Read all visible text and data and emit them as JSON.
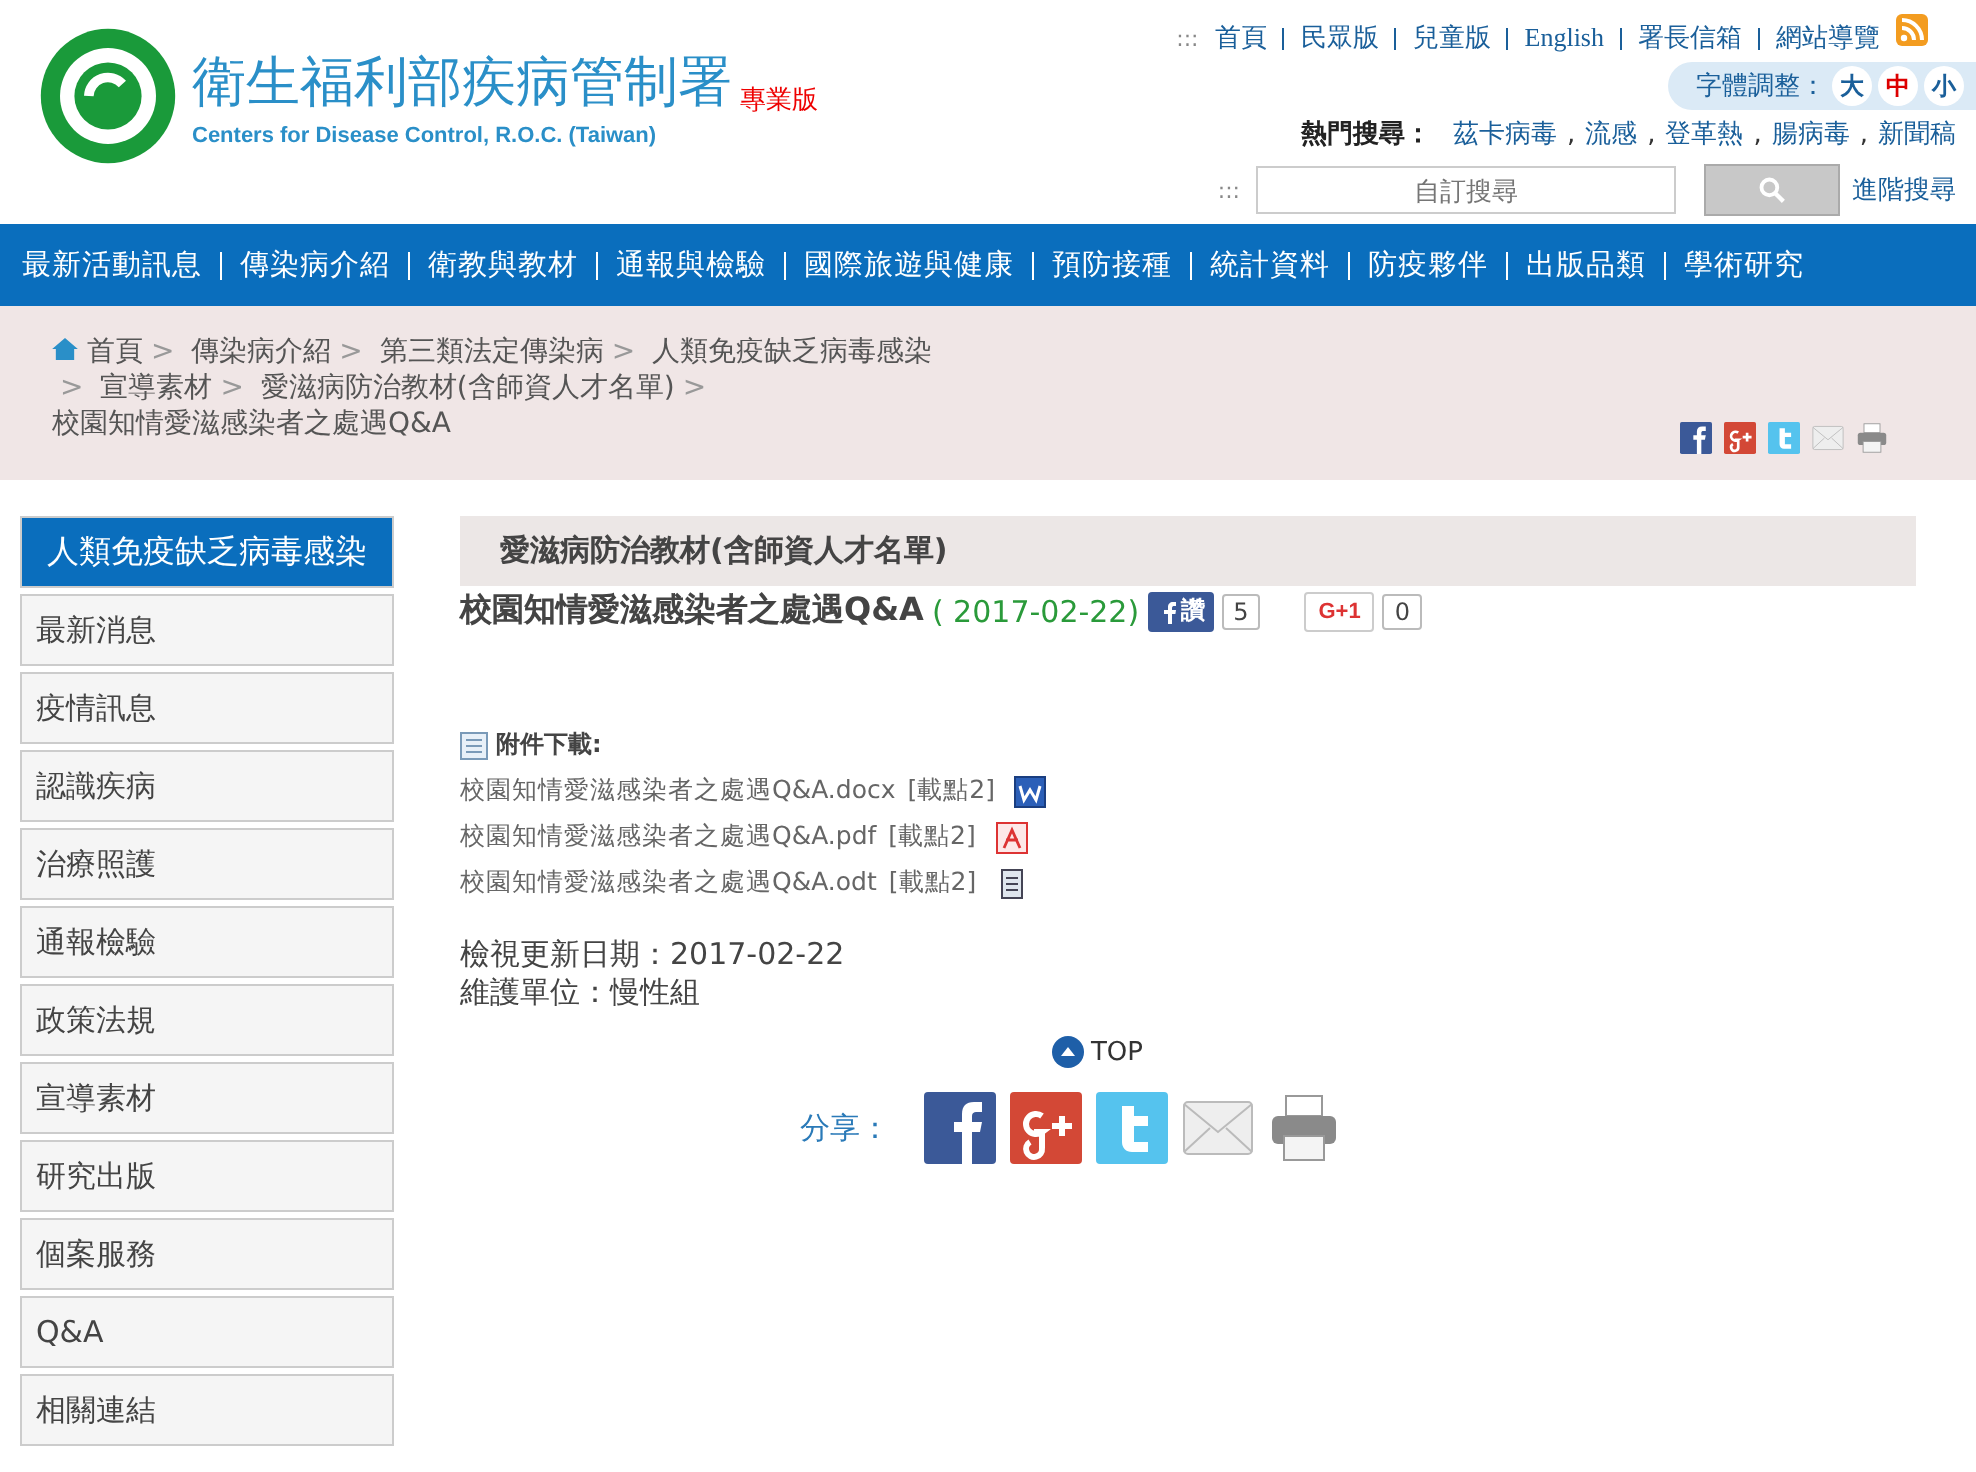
{
  "header": {
    "logo_title": "衛生福利部疾病管制署",
    "logo_subtitle": "Centers for Disease Control, R.O.C. (Taiwan)",
    "edition": "專業版",
    "top_marker": ":::",
    "top_links": [
      "首頁",
      "民眾版",
      "兒童版",
      "English",
      "署長信箱",
      "網站導覽"
    ],
    "font_size": {
      "label": "字體調整：",
      "options": [
        {
          "label": "大",
          "selected": false
        },
        {
          "label": "中",
          "selected": true
        },
        {
          "label": "小",
          "selected": false
        }
      ]
    },
    "hot_search": {
      "label": "熱門搜尋：",
      "terms": [
        {
          "text": "茲卡病毒",
          "sep": ","
        },
        {
          "text": "流感",
          "sep": ","
        },
        {
          "text": "登革熱",
          "sep": ","
        },
        {
          "text": "腸病毒",
          "sep": ","
        },
        {
          "text": "新聞稿"
        }
      ]
    },
    "search": {
      "marker": ":::",
      "placeholder": "自訂搜尋",
      "advanced_link": "進階搜尋"
    }
  },
  "nav": [
    "最新活動訊息",
    "傳染病介紹",
    "衛教與教材",
    "通報與檢驗",
    "國際旅遊與健康",
    "預防接種",
    "統計資料",
    "防疫夥伴",
    "出版品類",
    "學術研究"
  ],
  "breadcrumb": [
    {
      "text": "首頁"
    },
    {
      "sep": ">",
      "text": "傳染病介紹"
    },
    {
      "sep": ">",
      "text": "第三類法定傳染病"
    },
    {
      "sep": ">",
      "text": "人類免疫缺乏病毒感染"
    },
    {
      "sep": ">",
      "text": "宣導素材"
    },
    {
      "sep": ">",
      "text": "愛滋病防治教材(含師資人才名單)"
    },
    {
      "sep": ">",
      "text": "校園知情愛滋感染者之處遇Q&A"
    }
  ],
  "sidebar": [
    {
      "label": "人類免疫缺乏病毒感染",
      "selected": true
    },
    {
      "label": "最新消息",
      "selected": false
    },
    {
      "label": "疫情訊息",
      "selected": false
    },
    {
      "label": "認識疾病",
      "selected": false
    },
    {
      "label": "治療照護",
      "selected": false
    },
    {
      "label": "通報檢驗",
      "selected": false
    },
    {
      "label": "政策法規",
      "selected": false
    },
    {
      "label": "宣導素材",
      "selected": false
    },
    {
      "label": "研究出版",
      "selected": false
    },
    {
      "label": "個案服務",
      "selected": false
    },
    {
      "label": "Q&A",
      "selected": false
    },
    {
      "label": "相關連結",
      "selected": false
    }
  ],
  "content": {
    "section_title": "愛滋病防治教材(含師資人才名單)",
    "title": "校園知情愛滋感染者之處遇Q&A",
    "date": "( 2017-02-22)",
    "like_label": "讚",
    "like_count": "5",
    "plus_label": "G+1",
    "plus_count": "0",
    "attachments_label": "附件下載:",
    "attachments": [
      {
        "name": "校園知情愛滋感染者之處遇Q&A.docx",
        "clicks": "[載點2]",
        "kind": "word"
      },
      {
        "name": "校園知情愛滋感染者之處遇Q&A.pdf",
        "clicks": "[載點2]",
        "kind": "pdf"
      },
      {
        "name": "校園知情愛滋感染者之處遇Q&A.odt",
        "clicks": "[載點2]",
        "kind": "odt"
      }
    ],
    "updated": "檢視更新日期：2017-02-22",
    "unit": "維護單位：慢性組",
    "top": "TOP",
    "share_label": "分享："
  }
}
